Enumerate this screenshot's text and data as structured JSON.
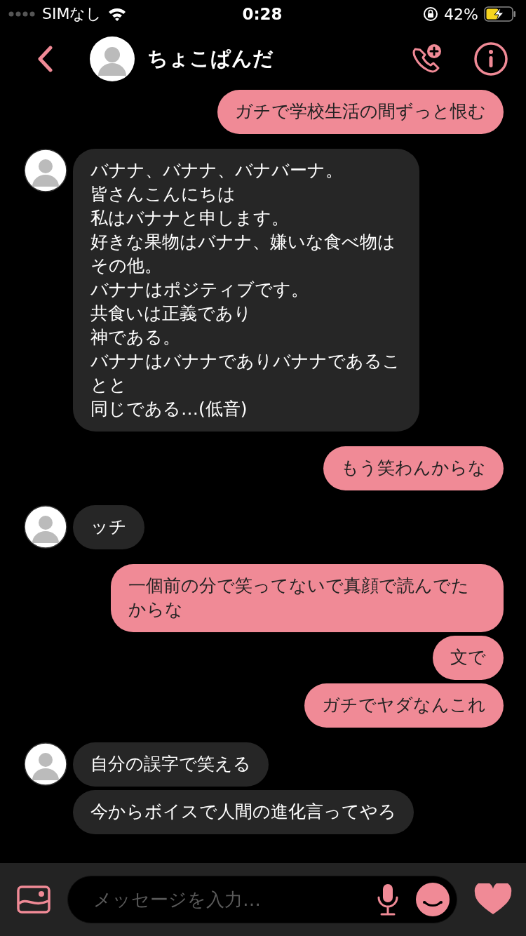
{
  "status_bar": {
    "carrier": "SIMなし",
    "time": "0:28",
    "battery": "42%"
  },
  "header": {
    "name": "ちょこぱんだ"
  },
  "messages": [
    {
      "kind": "outgoing",
      "lines": [
        "ガチで学校生活の間ずっと恨む"
      ]
    },
    {
      "kind": "incoming",
      "lines": [
        "バナナ、バナナ、バナバーナ。",
        "皆さんこんにちは",
        "私はバナナと申します。",
        "好きな果物はバナナ、嫌いな食べ物はその他。",
        "バナナはポジティブです。",
        "共食いは正義であり",
        "神である。",
        "バナナはバナナでありバナナであることと",
        "同じである…(低音)"
      ]
    },
    {
      "kind": "outgoing",
      "lines": [
        "もう笑わんからな"
      ]
    },
    {
      "kind": "incoming",
      "lines": [
        "ッチ"
      ]
    },
    {
      "kind": "outgoing",
      "lines": [
        "一個前の分で笑ってないで真顔で読んでたからな"
      ]
    },
    {
      "kind": "outgoing",
      "lines": [
        "文で"
      ]
    },
    {
      "kind": "outgoing",
      "lines": [
        "ガチでヤダなんこれ"
      ]
    },
    {
      "kind": "incoming",
      "lines": [
        "自分の誤字で笑える"
      ]
    },
    {
      "kind": "incoming",
      "lines": [
        "今からボイスで人間の進化言ってやろ"
      ]
    }
  ],
  "composer": {
    "placeholder": "メッセージを入力…"
  }
}
